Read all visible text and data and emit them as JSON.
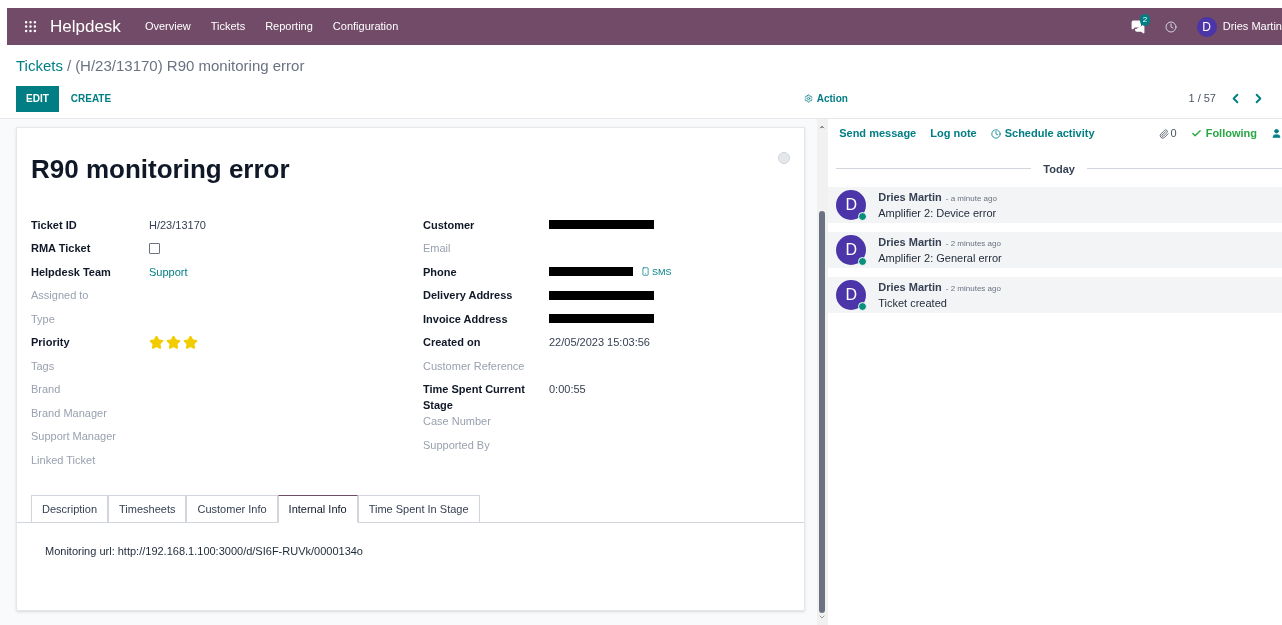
{
  "navbar": {
    "app": "Helpdesk",
    "menu": [
      "Overview",
      "Tickets",
      "Reporting",
      "Configuration"
    ],
    "messages_badge": "2",
    "user_initial": "D",
    "user_name": "Dries Martin"
  },
  "breadcrumb": {
    "parent": "Tickets",
    "separator": "/",
    "current": "(H/23/13170) R90 monitoring error"
  },
  "control_panel": {
    "buttons": [
      "EDIT",
      "CREATE"
    ],
    "action": "Action",
    "pager": "1 / 57"
  },
  "ticket": {
    "title": "R90 monitoring error",
    "left_fields": [
      {
        "label": "Ticket ID",
        "muted": false,
        "kind": "text",
        "value": "H/23/13170"
      },
      {
        "label": "RMA Ticket",
        "muted": false,
        "kind": "checkbox",
        "checked": false
      },
      {
        "label": "Helpdesk Team",
        "muted": false,
        "kind": "link",
        "value": "Support"
      },
      {
        "label": "Assigned to",
        "muted": true,
        "kind": "empty"
      },
      {
        "label": "Type",
        "muted": true,
        "kind": "empty"
      },
      {
        "label": "Priority",
        "muted": false,
        "kind": "stars",
        "stars": 3
      },
      {
        "label": "Tags",
        "muted": true,
        "kind": "empty"
      },
      {
        "label": "Brand",
        "muted": true,
        "kind": "empty"
      },
      {
        "label": "Brand Manager",
        "muted": true,
        "kind": "empty"
      },
      {
        "label": "Support Manager",
        "muted": true,
        "kind": "empty"
      },
      {
        "label": "Linked Ticket",
        "muted": true,
        "kind": "empty"
      }
    ],
    "right_fields": [
      {
        "label": "Customer",
        "muted": false,
        "kind": "redacted"
      },
      {
        "label": "Email",
        "muted": true,
        "kind": "empty"
      },
      {
        "label": "Phone",
        "muted": false,
        "kind": "redacted",
        "sms": "SMS"
      },
      {
        "label": "Delivery Address",
        "muted": false,
        "kind": "redacted"
      },
      {
        "label": "Invoice Address",
        "muted": false,
        "kind": "redacted"
      },
      {
        "label": "Created on",
        "muted": false,
        "kind": "text",
        "value": "22/05/2023 15:03:56"
      },
      {
        "label": "Customer Reference",
        "muted": true,
        "kind": "empty"
      },
      {
        "label": "Time Spent Current Stage",
        "muted": false,
        "kind": "text",
        "value": "0:00:55"
      },
      {
        "label": "Case Number",
        "muted": true,
        "kind": "empty"
      },
      {
        "label": "Supported By",
        "muted": true,
        "kind": "empty"
      }
    ],
    "tabs": [
      {
        "label": "Description",
        "selected": false
      },
      {
        "label": "Timesheets",
        "selected": false
      },
      {
        "label": "Customer Info",
        "selected": false
      },
      {
        "label": "Internal Info",
        "selected": true
      },
      {
        "label": "Time Spent In Stage",
        "selected": false
      }
    ],
    "tab_content": "Monitoring url: http://192.168.1.100:3000/d/SI6F-RUVk/0000134o"
  },
  "chatter": {
    "actions": [
      "Send message",
      "Log note"
    ],
    "schedule": "Schedule activity",
    "attachments": "0",
    "following": "Following",
    "divider": "Today",
    "messages": [
      {
        "initial": "D",
        "author": "Dries Martin",
        "time": "- a minute ago",
        "body": "Amplifier 2: Device error"
      },
      {
        "initial": "D",
        "author": "Dries Martin",
        "time": "- 2 minutes ago",
        "body": "Amplifier 2: General error"
      },
      {
        "initial": "D",
        "author": "Dries Martin",
        "time": "- 2 minutes ago",
        "body": "Ticket created"
      }
    ]
  }
}
